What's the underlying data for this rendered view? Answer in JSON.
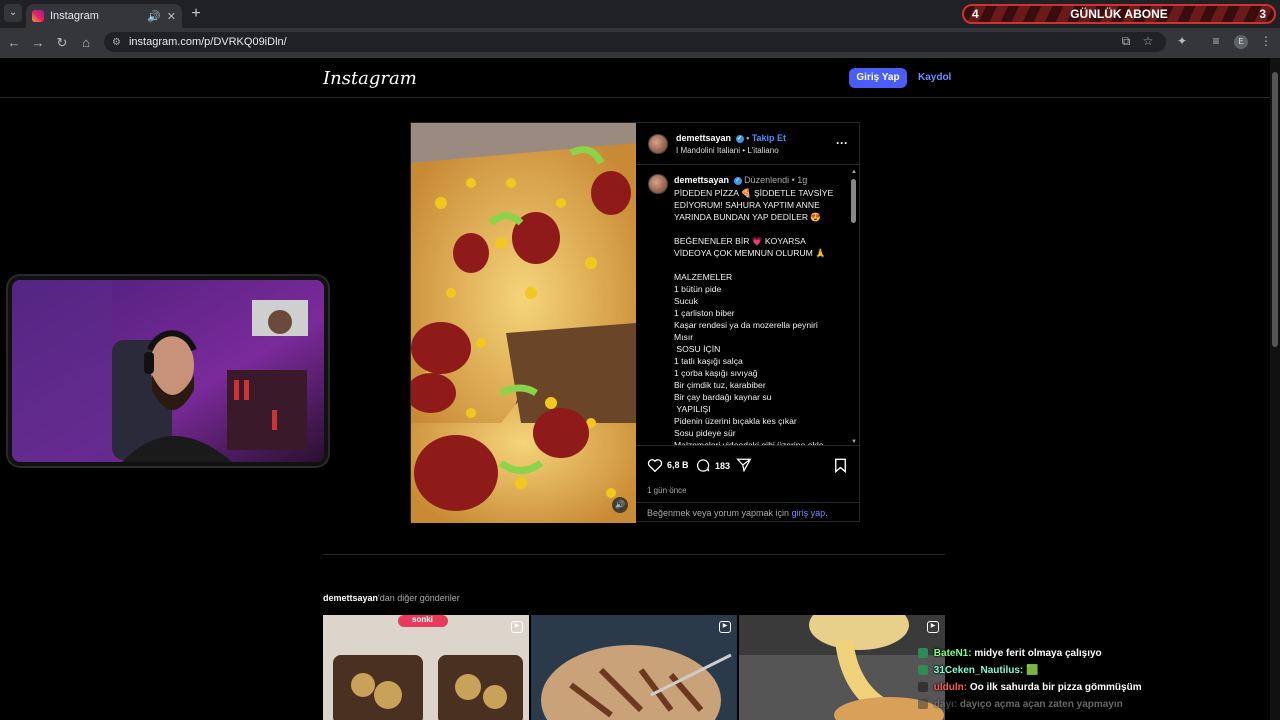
{
  "browser": {
    "tab_title": "Instagram",
    "url": "instagram.com/p/DVRKQ09iDln/",
    "profile_letter": "E"
  },
  "stream_overlay": {
    "abone_left": "4",
    "abone_label": "GÜNLÜK ABONE",
    "abone_right": "3"
  },
  "header": {
    "logo": "Instagram",
    "login_label": "Giriş Yap",
    "signup_label": "Kaydol"
  },
  "post": {
    "username": "demettsayan",
    "follow_label": "Takip Et",
    "audio": "I Mandolini Italiani",
    "audio_sep": "•",
    "audio_artist": "L'italiano",
    "caption_meta": "Düzenlendi • 1g",
    "caption": "PİDEDEN PİZZA 🍕 ŞİDDETLE TAVSİYE EDİYORUM! SAHURA YAPTIM ANNE YARINDA BUNDAN YAP DEDİLER 😍\n\nBEĞENENLER BİR 💗 KOYARSA VİDEOYA ÇOK MEMNUN OLURUM 🙏\n\nMALZEMELER\n1 bütün pide\nSucuk\n1 çarliston biber\nKaşar rendesi ya da mozerella peyniri\nMısır\n SOSU İÇİN\n1 tatlı kaşığı salça\n1 çorba kaşığı sıvıyağ\nBir çimdik tuz, karabiber\nBir çay bardağı kaynar su\n YAPILIŞI\nPidenin üzerini bıçakla kes çıkar\nSosu pideye sür\nMalzemeleri videodaki gibi üzerine ekle",
    "likes": "6,8 B",
    "comments": "183",
    "time_ago": "1 gün önce",
    "login_prompt": "Beğenmek veya yorum yapmak için",
    "login_prompt_link": "giriş yap",
    "login_prompt_end": "."
  },
  "more_posts": {
    "username": "demettsayan",
    "suffix": "'dan diğer gönderiler",
    "first_label": "sonki"
  },
  "chat": [
    {
      "user": "BateN1:",
      "msg": "midye ferit olmaya çalışıyo",
      "color": "#7fff7f"
    },
    {
      "user": "31Ceken_Nautilus:",
      "msg": "🟩",
      "color": "#7fffd4"
    },
    {
      "user": "ulduln:",
      "msg": "Oo ilk sahurda bir pizza gömmüşüm",
      "color": "#ff5a5a"
    },
    {
      "user": "dayı:",
      "msg": "dayıço açma açan zaten yapmayın",
      "color": "#888888"
    }
  ]
}
